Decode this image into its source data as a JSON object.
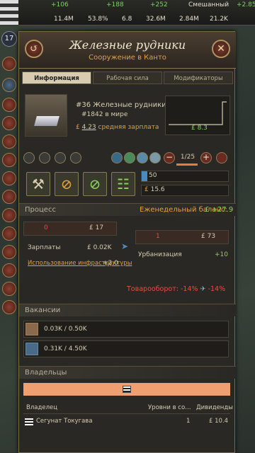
{
  "topbar": {
    "stats": [
      {
        "label": "+106",
        "kind": "g"
      },
      {
        "label": "+188",
        "kind": "g"
      },
      {
        "label": "+252",
        "kind": "g"
      },
      {
        "label": "Смешанный",
        "kind": "w"
      },
      {
        "label": "+2.85",
        "kind": "g"
      },
      {
        "label": "11.4M",
        "kind": "w"
      },
      {
        "label": "53.8%",
        "kind": "w"
      },
      {
        "label": "6.8",
        "kind": "w"
      },
      {
        "label": "32.6M",
        "kind": "w"
      },
      {
        "label": "2.84M",
        "kind": "w"
      },
      {
        "label": "21.2K",
        "kind": "w"
      }
    ],
    "level": "17"
  },
  "panel": {
    "title": "Железные рудники",
    "subtitle": "Сооружение в Канто",
    "tabs": [
      "Информация",
      "Рабочая сила",
      "Модификаторы"
    ],
    "info": {
      "rank": "#36",
      "name": "Железные рудники",
      "world_rank": "#1842",
      "world_rank_suffix": "в мире",
      "avg_wage": "4.23",
      "avg_wage_label": "средняя зарплата",
      "chart_value": "8.3",
      "levels": "1/25",
      "input_value": "50",
      "money_value": "15.6"
    },
    "process": {
      "title": "Процесс",
      "balance_label": "Еженедельный баланс:",
      "balance_value": "+27.9",
      "input_count": "0",
      "input_price": "17",
      "wages_label": "Зарплаты",
      "wages_value": "0.02K",
      "infra_label": "Использование инфраструктуры",
      "infra_value": "+2.0",
      "output_count": "1",
      "output_price": "73",
      "urban_label": "Урбанизация",
      "urban_value": "+10",
      "turnover_label": "Товарооборот:",
      "turnover_a": "-14%",
      "turnover_b": "-14%"
    },
    "vacancies": {
      "title": "Вакансии",
      "rows": [
        "0.03K / 0.50K",
        "0.31K / 4.50K"
      ]
    },
    "owners": {
      "title": "Владельцы",
      "col_owner": "Владелец",
      "col_level": "Уровни в со…",
      "col_div": "Дивиденды",
      "owner_name": "Сегунат Токугава",
      "owner_level": "1",
      "owner_div": "10.4"
    }
  },
  "colors": {
    "accent": "#e0a040",
    "positive": "#8ad060",
    "negative": "#e05040",
    "owner_bar": "#f0a070"
  }
}
